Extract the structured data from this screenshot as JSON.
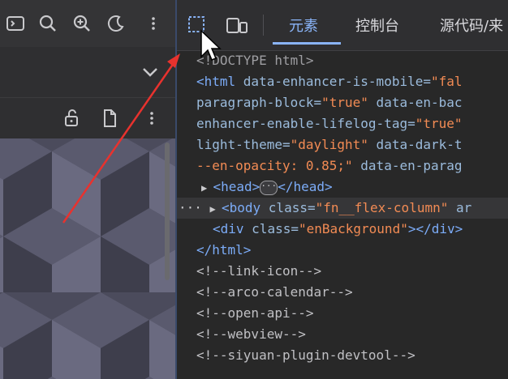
{
  "left_toolbar": {
    "icons": [
      "terminal-icon",
      "search-icon",
      "zoom-in-icon",
      "moon-icon",
      "more-vert-icon"
    ]
  },
  "left_row3": {
    "icons": [
      "unlock-icon",
      "file-icon",
      "more-vert-icon"
    ]
  },
  "devtools": {
    "tabs": [
      {
        "label": "元素",
        "active": true
      },
      {
        "label": "控制台",
        "active": false
      },
      {
        "label": "源代码/来",
        "active": false
      }
    ],
    "toolbar_icons": [
      "inspect-element-icon",
      "device-toggle-icon"
    ],
    "accent": "#8ab4f8"
  },
  "code": {
    "doctype": "<!DOCTYPE html>",
    "l1_tag": "<html ",
    "l1_attr": "data-enhancer-is-mobile=",
    "l1_val": "\"fal",
    "l2_attr": "paragraph-block=",
    "l2_val": "\"true\"",
    "l2_attr2": " data-en-bac",
    "l3_attr": "enhancer-enable-lifelog-tag=",
    "l3_val": "\"true\"",
    "l4_attr": "light-theme=",
    "l4_val": "\"daylight\"",
    "l4_attr2": " data-dark-t",
    "l5_val": "--en-opacity: 0.85;\"",
    "l5_attr": " data-en-parag",
    "head_open": "<head>",
    "head_badge": "···",
    "head_close": "</head>",
    "body_dots": "···",
    "body_tag": "<body ",
    "body_attr": "class=",
    "body_val": "\"fn__flex-column\"",
    "body_rest": " ar",
    "div_tag": "<div ",
    "div_attr": "class=",
    "div_val": "\"enBackground\"",
    "div_close": "></div>",
    "html_close": "</html>",
    "comments": [
      "<!--link-icon-->",
      "<!--arco-calendar-->",
      "<!--open-api-->",
      "<!--webview-->",
      "<!--siyuan-plugin-devtool-->"
    ]
  },
  "colors": {
    "tag": "#7cacf8",
    "attr": "#9bbbdc",
    "value": "#f28b54",
    "arrow": "#e8322e"
  }
}
